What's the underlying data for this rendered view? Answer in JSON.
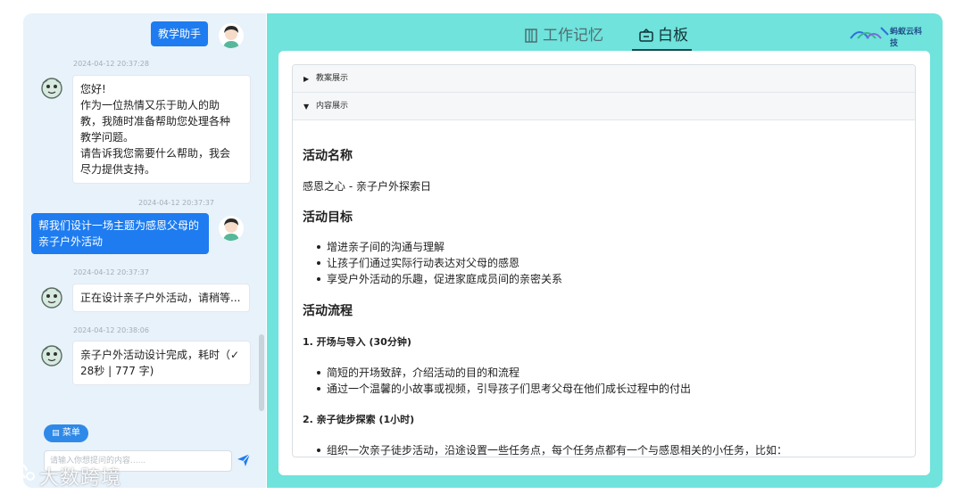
{
  "chat": {
    "header_user_label": "教学助手",
    "messages": [
      {
        "time": "2024-04-12 20:37:28",
        "role": "bot",
        "lines": [
          "您好!",
          "作为一位热情又乐于助人的助",
          "教，我随时准备帮助您处理各种",
          "教学问题。",
          "请告诉我您需要什么帮助，我会",
          "尽力提供支持。"
        ]
      },
      {
        "time": "2024-04-12 20:37:37",
        "role": "user",
        "lines": [
          "帮我们设计一场主题为感恩父母的",
          "亲子户外活动"
        ]
      },
      {
        "time": "2024-04-12 20:37:37",
        "role": "bot",
        "lines": [
          "正在设计亲子户外活动，请稍等..."
        ]
      },
      {
        "time": "2024-04-12 20:38:06",
        "role": "bot",
        "lines": [
          "亲子户外活动设计完成，耗时（✓",
          "28秒 | 777 字)"
        ]
      }
    ],
    "menu_label": "菜单",
    "input_placeholder": "请输入你想提问的内容......"
  },
  "board": {
    "tabs": [
      {
        "label": "工作记忆",
        "icon": "notebook-icon",
        "active": false
      },
      {
        "label": "白板",
        "icon": "whiteboard-icon",
        "active": true
      }
    ],
    "logo_text": "蚂蚁云科技",
    "sections": [
      {
        "label": "教案展示",
        "expanded": false
      },
      {
        "label": "内容展示",
        "expanded": true
      }
    ],
    "content": {
      "activity_name_heading": "活动名称",
      "activity_name": "感恩之心 - 亲子户外探索日",
      "goal_heading": "活动目标",
      "goals": [
        "增进亲子间的沟通与理解",
        "让孩子们通过实际行动表达对父母的感恩",
        "享受户外活动的乐趣，促进家庭成员间的亲密关系"
      ],
      "flow_heading": "活动流程",
      "step1_heading": "1. 开场与导入 (30分钟)",
      "step1_items": [
        "简短的开场致辞，介绍活动的目的和流程",
        "通过一个温馨的小故事或视频，引导孩子们思考父母在他们成长过程中的付出"
      ],
      "step2_heading": "2. 亲子徒步探索 (1小时)",
      "step2_items": [
        "组织一次亲子徒步活动，沿途设置一些任务点，每个任务点都有一个与感恩相关的小任务，比如："
      ]
    }
  },
  "watermark": "大数跨境",
  "colors": {
    "accent": "#1e7cf0",
    "board_bg": "#6fe3dc",
    "chat_bg": "#e8f2fb"
  }
}
